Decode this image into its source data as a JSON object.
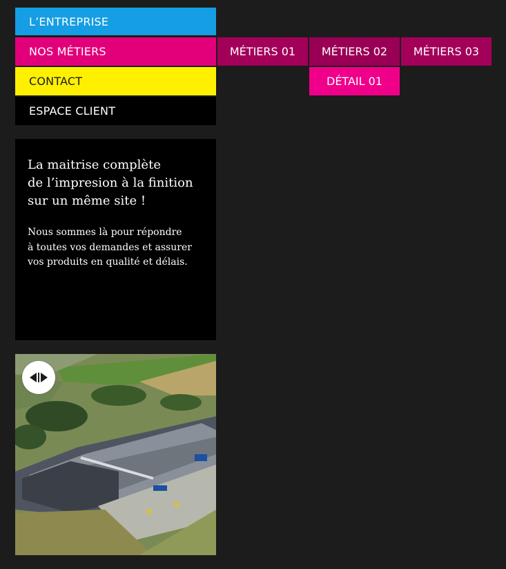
{
  "nav": {
    "items": [
      {
        "label": "L’ENTREPRISE"
      },
      {
        "label": "NOS MÉTIERS"
      },
      {
        "label": "CONTACT"
      },
      {
        "label": "ESPACE CLIENT"
      }
    ]
  },
  "submenu": {
    "items": [
      {
        "label": "MÉTIERS 01"
      },
      {
        "label": "MÉTIERS 02"
      },
      {
        "label": "MÉTIERS 03"
      }
    ],
    "detail": {
      "label": "DÉTAIL 01"
    }
  },
  "info": {
    "title": "La maitrise complète\nde l’impresion à la finition\nsur un même site !",
    "text": "Nous sommes là pour répondre\nà toutes vos demandes et assurer\nvos produits en qualité et délais."
  },
  "slider": {
    "icon": "arrows-left-right-icon"
  },
  "colors": {
    "background": "#1c1c1c",
    "cyan": "#159ee3",
    "magenta": "#e2007a",
    "yellow": "#fff000",
    "black": "#000000",
    "submenu": "#a3005a",
    "detail": "#f0008a"
  }
}
